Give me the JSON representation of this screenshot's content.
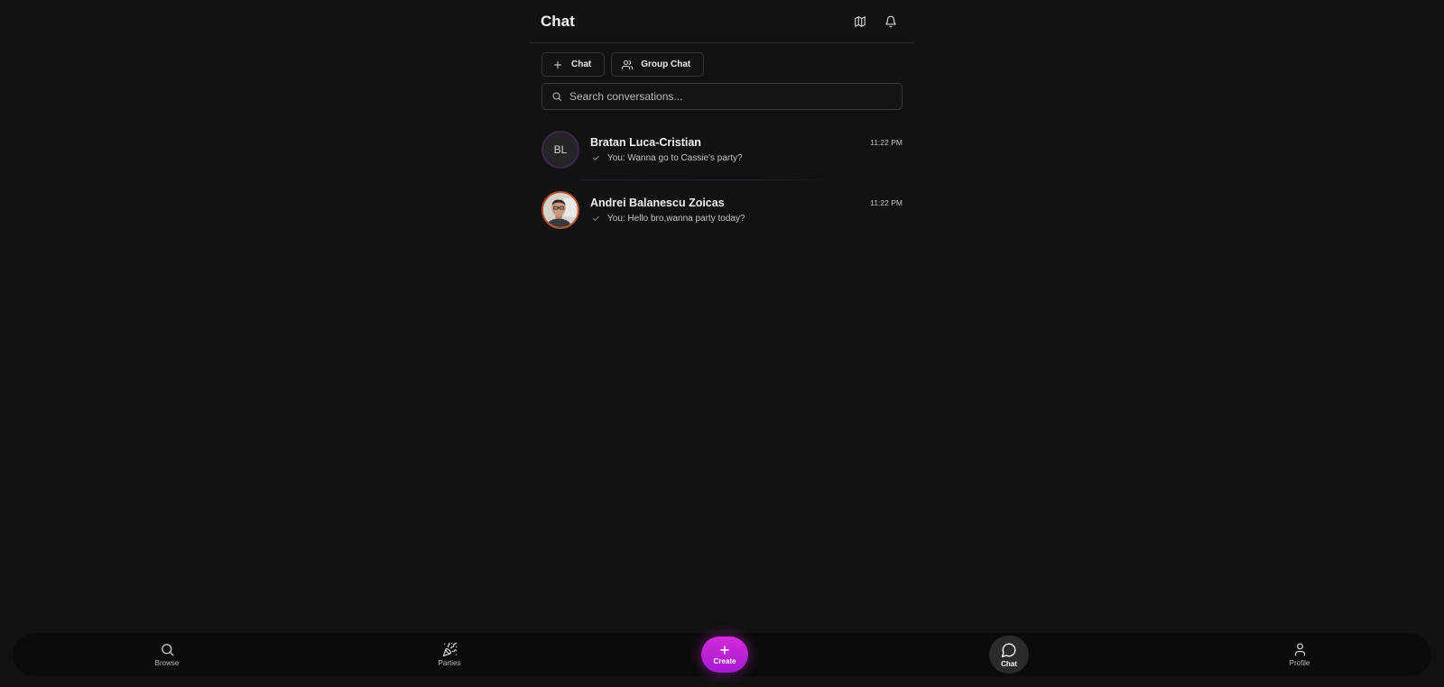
{
  "header": {
    "title": "Chat",
    "icons": [
      "map-icon",
      "bell-icon"
    ]
  },
  "actions": {
    "new_chat_label": "Chat",
    "group_chat_label": "Group Chat"
  },
  "search": {
    "placeholder": "Search conversations..."
  },
  "conversations": [
    {
      "initials": "BL",
      "name": "Bratan Luca-Cristian",
      "time": "11:22 PM",
      "last_message": "You: Wanna go to Cassie's party?",
      "read_icon": "check-icon"
    },
    {
      "name": "Andrei Balanescu Zoicas",
      "time": "11:22 PM",
      "last_message": "You: Hello bro,wanna party today?",
      "read_icon": "check-icon",
      "avatar": "photo"
    }
  ],
  "bottom_nav": {
    "browse": "Browse",
    "parties": "Parties",
    "create": "Create",
    "chat": "Chat",
    "profile": "Profile",
    "active": "chat"
  },
  "colors": {
    "background": "#121212",
    "accent": "#c425d6",
    "nav_background": "#0b0b0b"
  }
}
